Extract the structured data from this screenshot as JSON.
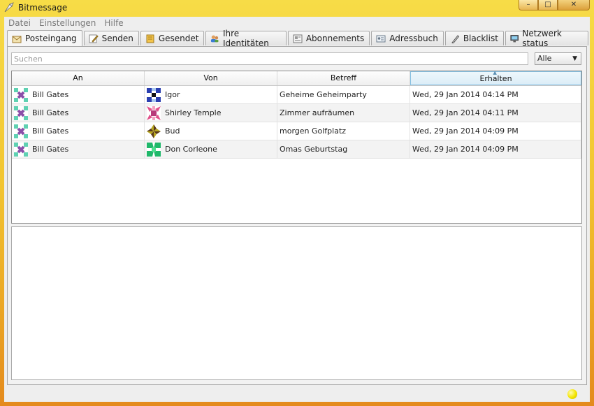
{
  "window": {
    "title": "Bitmessage",
    "minimize": "–",
    "maximize": "□",
    "close": "✕"
  },
  "menu": [
    "Datei",
    "Einstellungen",
    "Hilfe"
  ],
  "tabs": [
    {
      "label": "Posteingang",
      "icon": "inbox-icon",
      "active": true
    },
    {
      "label": "Senden",
      "icon": "compose-icon"
    },
    {
      "label": "Gesendet",
      "icon": "sent-icon"
    },
    {
      "label": "Ihre Identitäten",
      "icon": "identities-icon"
    },
    {
      "label": "Abonnements",
      "icon": "subscriptions-icon"
    },
    {
      "label": "Adressbuch",
      "icon": "addressbook-icon"
    },
    {
      "label": "Blacklist",
      "icon": "blacklist-icon"
    },
    {
      "label": "Netzwerk status",
      "icon": "network-icon"
    }
  ],
  "search": {
    "placeholder": "Suchen",
    "value": ""
  },
  "filter": {
    "selected": "Alle"
  },
  "table": {
    "columns": [
      "An",
      "Von",
      "Betreff",
      "Erhalten"
    ],
    "sorted_column": "Erhalten",
    "rows": [
      {
        "to": "Bill Gates",
        "from": "Igor",
        "subject": "Geheime Geheimparty",
        "received": "Wed, 29 Jan 2014  04:14 PM"
      },
      {
        "to": "Bill Gates",
        "from": "Shirley Temple",
        "subject": "Zimmer aufräumen",
        "received": "Wed, 29 Jan 2014  04:11 PM"
      },
      {
        "to": "Bill Gates",
        "from": "Bud",
        "subject": "morgen Golfplatz",
        "received": "Wed, 29 Jan 2014  04:09 PM"
      },
      {
        "to": "Bill Gates",
        "from": "Don Corleone",
        "subject": "Omas Geburtstag",
        "received": "Wed, 29 Jan 2014  04:09 PM"
      }
    ]
  },
  "colors": {
    "accent": "#86c1e3",
    "frame": "#f2c531",
    "status_ok": "#f3e500"
  }
}
